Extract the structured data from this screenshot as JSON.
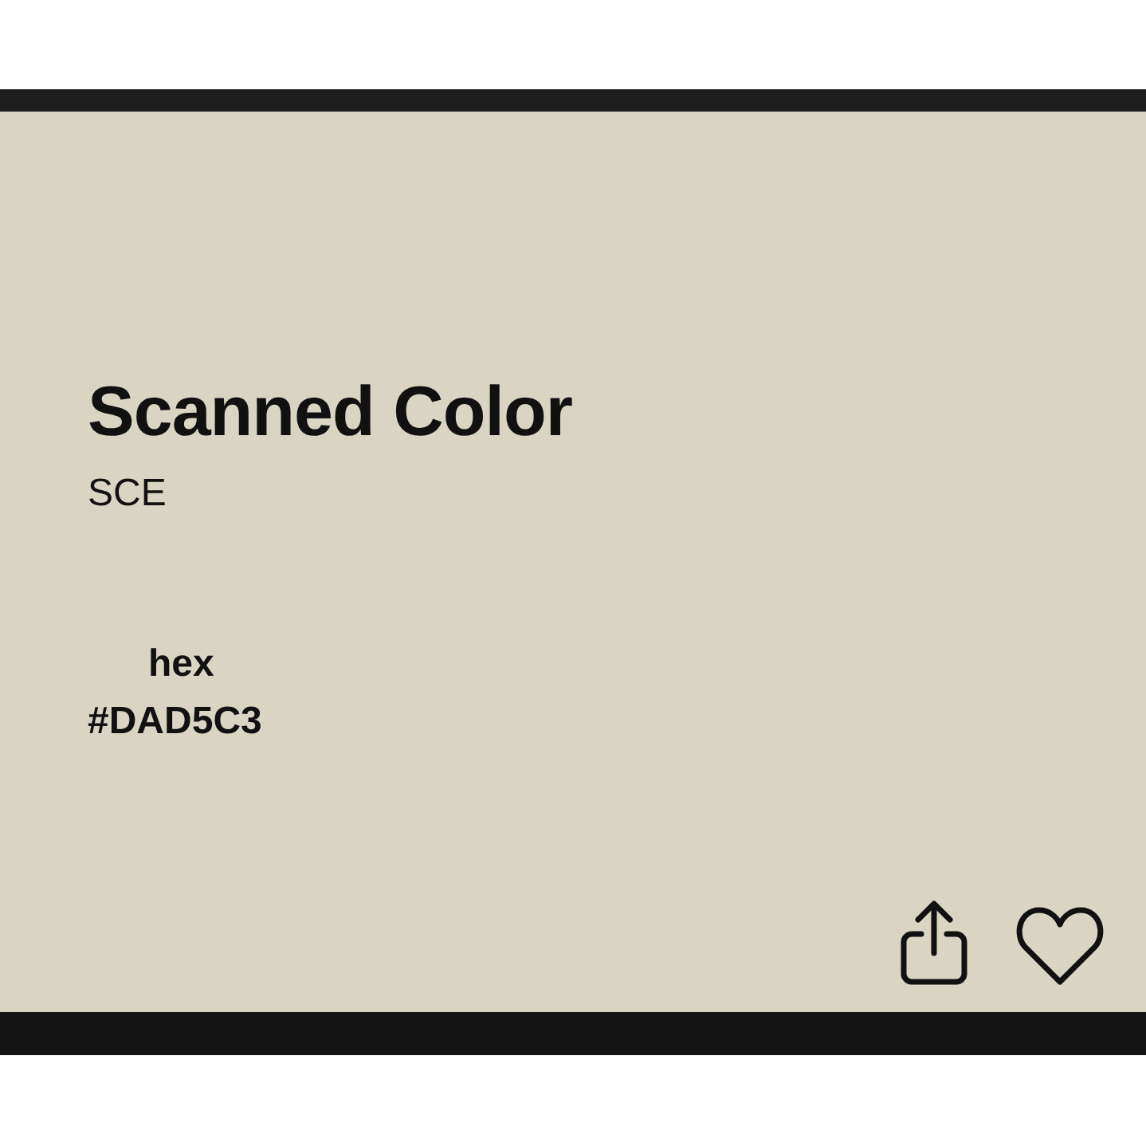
{
  "card": {
    "color": "#dad5c3",
    "title": "Scanned Color",
    "subtitle": "SCE",
    "fields": [
      {
        "label": "hex",
        "value": "#DAD5C3"
      }
    ],
    "favorited": false
  }
}
